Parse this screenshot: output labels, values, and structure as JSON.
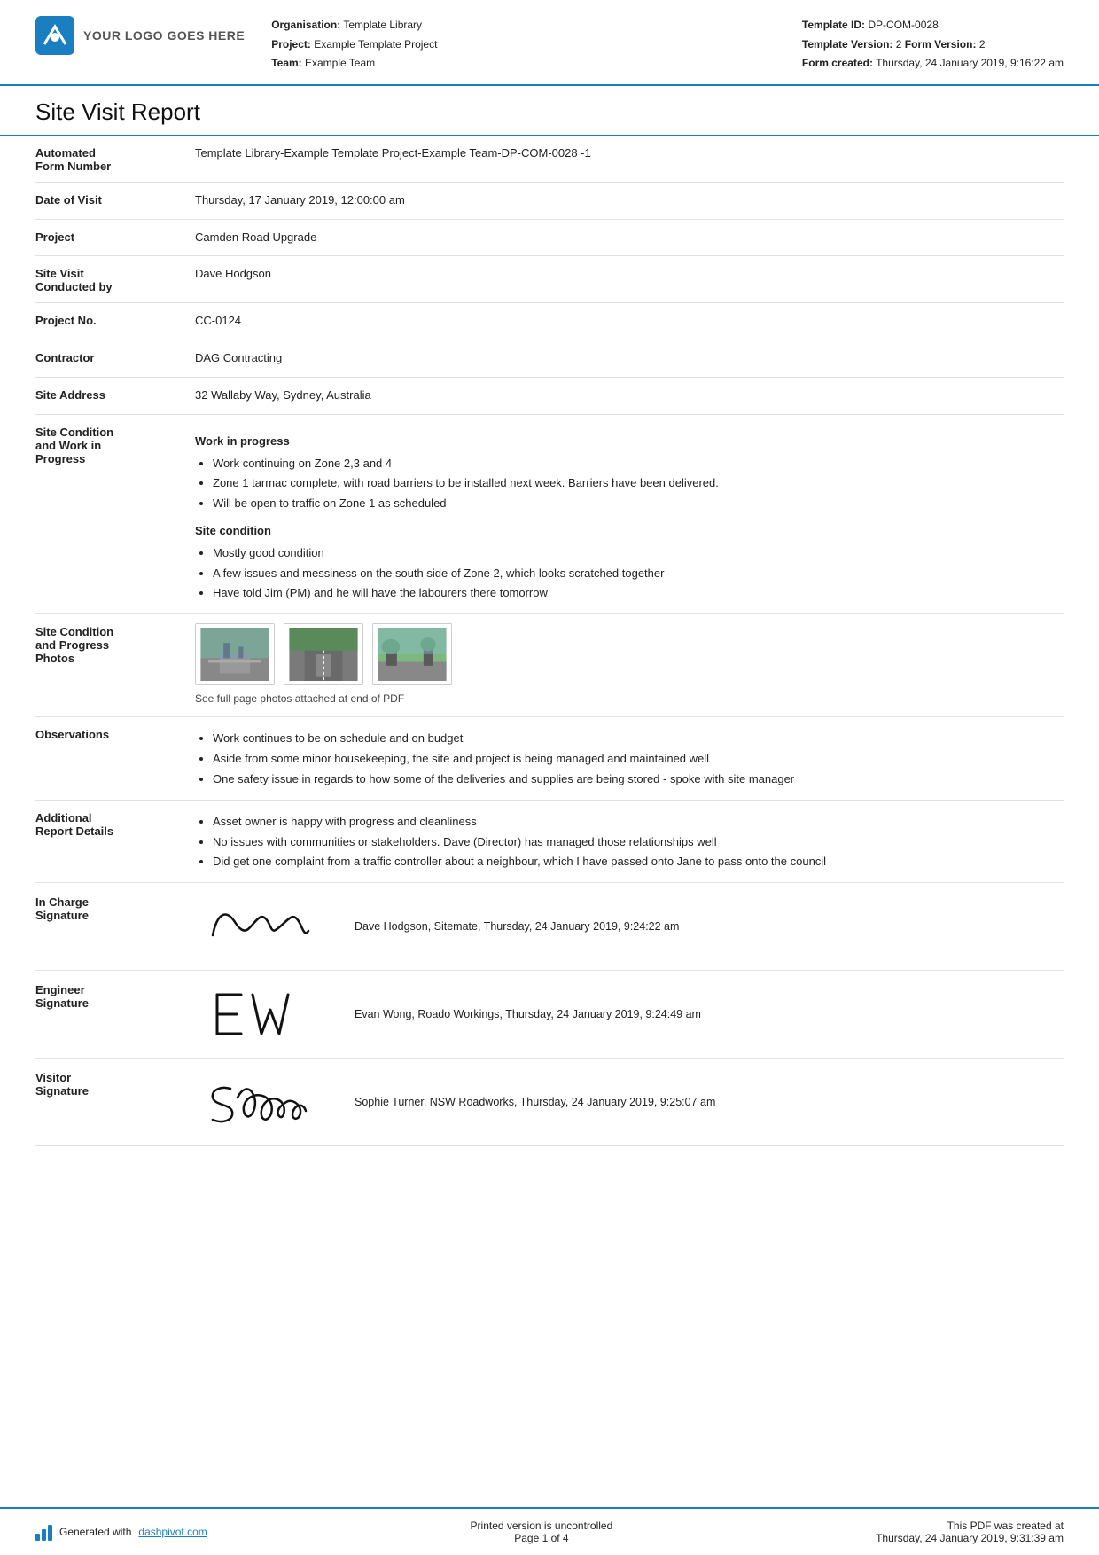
{
  "header": {
    "logo_text": "YOUR LOGO GOES HERE",
    "org_label": "Organisation:",
    "org_value": "Template Library",
    "project_label": "Project:",
    "project_value": "Example Template Project",
    "team_label": "Team:",
    "team_value": "Example Team",
    "template_id_label": "Template ID:",
    "template_id_value": "DP-COM-0028",
    "template_version_label": "Template Version:",
    "template_version_value": "2",
    "form_version_label": "Form Version:",
    "form_version_value": "2",
    "form_created_label": "Form created:",
    "form_created_value": "Thursday, 24 January 2019, 9:16:22 am"
  },
  "report": {
    "title": "Site Visit Report",
    "fields": [
      {
        "label": "Automated Form Number",
        "value": "Template Library-Example Template Project-Example Team-DP-COM-0028   -1"
      },
      {
        "label": "Date of Visit",
        "value": "Thursday, 17 January 2019, 12:00:00 am"
      },
      {
        "label": "Project",
        "value": "Camden Road Upgrade"
      },
      {
        "label": "Site Visit Conducted by",
        "value": "Dave Hodgson"
      },
      {
        "label": "Project No.",
        "value": "CC-0124"
      },
      {
        "label": "Contractor",
        "value": "DAG Contracting"
      },
      {
        "label": "Site Address",
        "value": "32 Wallaby Way, Sydney, Australia"
      }
    ],
    "site_condition": {
      "label": "Site Condition and Work in Progress",
      "work_heading": "Work in progress",
      "work_items": [
        "Work continuing on Zone 2,3 and 4",
        "Zone 1 tarmac complete, with road barriers to be installed next week. Barriers have been delivered.",
        "Will be open to traffic on Zone 1 as scheduled"
      ],
      "condition_heading": "Site condition",
      "condition_items": [
        "Mostly good condition",
        "A few issues and messiness on the south side of Zone 2, which looks scratched together",
        "Have told Jim (PM) and he will have the labourers there tomorrow"
      ]
    },
    "photos": {
      "label": "Site Condition and Progress Photos",
      "caption": "See full page photos attached at end of PDF"
    },
    "observations": {
      "label": "Observations",
      "items": [
        "Work continues to be on schedule and on budget",
        "Aside from some minor housekeeping, the site and project is being managed and maintained well",
        "One safety issue in regards to how some of the deliveries and supplies are being stored - spoke with site manager"
      ]
    },
    "additional": {
      "label": "Additional Report Details",
      "items": [
        "Asset owner is happy with progress and cleanliness",
        "No issues with communities or stakeholders. Dave (Director) has managed those relationships well",
        "Did get one complaint from a traffic controller about a neighbour, which I have passed onto Jane to pass onto the council"
      ]
    },
    "signatures": [
      {
        "label": "In Charge Signature",
        "sig_type": "cursive",
        "sig_text": "Dave Hodgson, Sitemate, Thursday, 24 January 2019, 9:24:22 am"
      },
      {
        "label": "Engineer Signature",
        "sig_type": "initials_ew",
        "sig_text": "Evan Wong, Roado Workings, Thursday, 24 January 2019, 9:24:49 am"
      },
      {
        "label": "Visitor Signature",
        "sig_type": "cursive_sophie",
        "sig_text": "Sophie Turner, NSW Roadworks, Thursday, 24 January 2019, 9:25:07 am"
      }
    ]
  },
  "footer": {
    "generated_text": "Generated with",
    "dashpivot_link": "dashpivot.com",
    "uncontrolled_text": "Printed version is uncontrolled",
    "page_label": "Page 1 of 4",
    "pdf_created_label": "This PDF was created at",
    "pdf_created_value": "Thursday, 24 January 2019, 9:31:39 am"
  }
}
